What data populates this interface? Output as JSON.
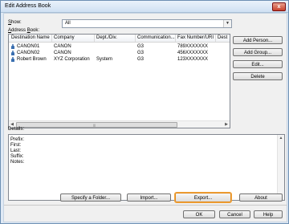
{
  "window": {
    "title": "Edit Address Book",
    "close_glyph": "x"
  },
  "show": {
    "label_prefix": "S",
    "label_rest": "how:",
    "value": "All"
  },
  "address_book": {
    "label_prefix": "A",
    "label_mid": "ddress ",
    "label_u": "B",
    "label_rest": "ook:"
  },
  "columns": [
    "Destination Name",
    "Company",
    "Dept./Div.",
    "Communication...",
    "Fax Number/URI",
    "Dest"
  ],
  "rows": [
    {
      "name": "CANON01",
      "company": "CANON",
      "dept": "",
      "comm": "G3",
      "fax": "789XXXXXXX"
    },
    {
      "name": "CANON02",
      "company": "CANON",
      "dept": "",
      "comm": "G3",
      "fax": "456XXXXXXX"
    },
    {
      "name": "Robert Brown",
      "company": "XYZ Corporation",
      "dept": "System",
      "comm": "G3",
      "fax": "123XXXXXXX"
    }
  ],
  "side_buttons": {
    "add_person": "Add Person...",
    "add_group": "Add Group...",
    "edit": "Edit...",
    "delete": "Delete"
  },
  "details": {
    "label": "Details:",
    "lines": [
      "Prefix:",
      "First:",
      "Last:",
      "Suffix:",
      "Notes:"
    ]
  },
  "bottom_buttons": {
    "specify_folder": "Specify a Folder...",
    "import": "Import...",
    "export": "Export...",
    "about": "About"
  },
  "dialog_buttons": {
    "ok": "OK",
    "cancel": "Cancel",
    "help": "Help"
  },
  "colors": {
    "highlight": "#f2a33a",
    "frame": "#6d8fb3",
    "person_icon": "#3a6fb0"
  }
}
